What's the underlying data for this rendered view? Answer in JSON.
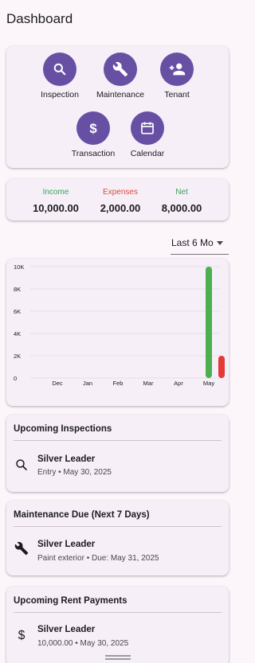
{
  "app": {
    "title": "Dashboard"
  },
  "quick_actions": [
    {
      "label": "Inspection",
      "icon": "search-icon"
    },
    {
      "label": "Maintenance",
      "icon": "wrench-icon"
    },
    {
      "label": "Tenant",
      "icon": "person-add-icon"
    },
    {
      "label": "Transaction",
      "icon": "dollar-icon"
    },
    {
      "label": "Calendar",
      "icon": "calendar-icon"
    }
  ],
  "summary": {
    "income": {
      "label": "Income",
      "value": "10,000.00",
      "color": "#3aa357"
    },
    "expenses": {
      "label": "Expenses",
      "value": "2,000.00",
      "color": "#e0493d"
    },
    "net": {
      "label": "Net",
      "value": "8,000.00",
      "color": "#3aa357"
    }
  },
  "period_select": {
    "value": "Last 6 Mo"
  },
  "chart_data": {
    "type": "bar",
    "categories": [
      "Dec",
      "Jan",
      "Feb",
      "Mar",
      "Apr",
      "May"
    ],
    "series": [
      {
        "values": [
          0,
          0,
          0,
          0,
          0,
          10000
        ],
        "color": "#4caf50"
      },
      {
        "values": [
          0,
          0,
          0,
          0,
          0,
          2000
        ],
        "color": "#e53935"
      }
    ],
    "y_ticks": [
      "0",
      "2K",
      "4K",
      "6K",
      "8K",
      "10K"
    ],
    "ylim": [
      0,
      10000
    ],
    "grid": true
  },
  "upcoming_inspections": {
    "title": "Upcoming Inspections",
    "items": [
      {
        "title": "Silver Leader",
        "subtitle": "Entry • May 30, 2025",
        "icon": "search-icon"
      }
    ]
  },
  "maintenance_due": {
    "title": "Maintenance Due (Next 7 Days)",
    "items": [
      {
        "title": "Silver Leader",
        "subtitle": "Paint exterior • Due: May 31, 2025",
        "icon": "wrench-icon"
      }
    ]
  },
  "upcoming_rent": {
    "title": "Upcoming Rent Payments",
    "items": [
      {
        "title": "Silver Leader",
        "subtitle": "10,000.00 • May 30, 2025",
        "icon": "dollar-icon"
      }
    ]
  }
}
